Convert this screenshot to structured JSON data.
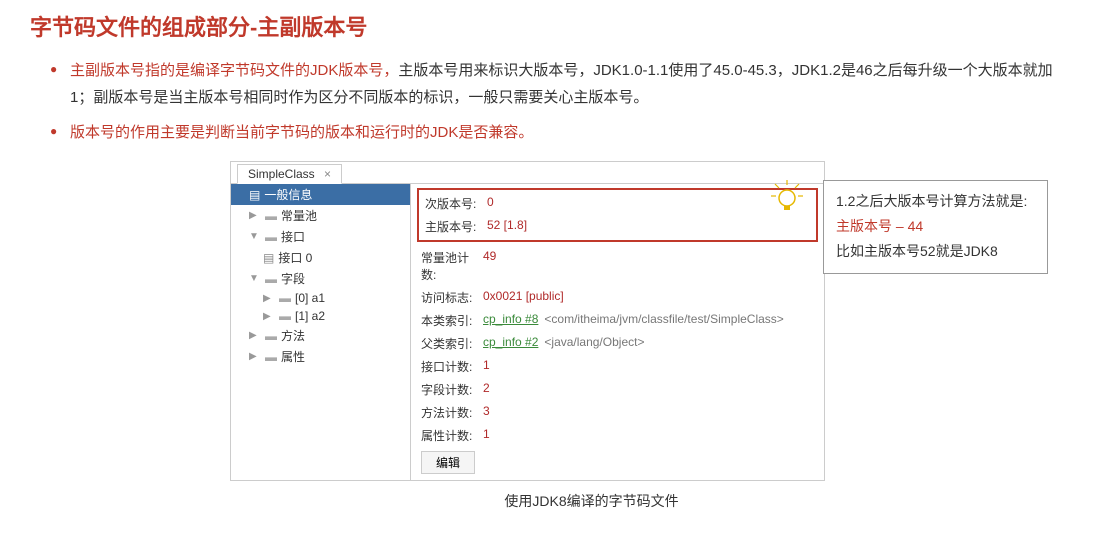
{
  "title": "字节码文件的组成部分-主副版本号",
  "bullets": {
    "b1_red": "主副版本号指的是编译字节码文件的JDK版本号，",
    "b1_black": "主版本号用来标识大版本号，JDK1.0-1.1使用了45.0-45.3，JDK1.2是46之后每升级一个大版本就加1；副版本号是当主版本号相同时作为区分不同版本的标识，一般只需要关心主版本号。",
    "b2_red": "版本号的作用主要是判断当前字节码的版本和运行时的JDK是否兼容。"
  },
  "infobox": {
    "line1": "1.2之后大版本号计算方法就是:",
    "line2": "主版本号 – 44",
    "line3": "比如主版本号52就是JDK8"
  },
  "lightbulb": "💡",
  "panel": {
    "tab": "SimpleClass",
    "tab_close": "×",
    "tree": {
      "n0": "一般信息",
      "n1": "常量池",
      "n2": "接口",
      "n2a": "接口 0",
      "n3": "字段",
      "n3a": "[0] a1",
      "n3b": "[1] a2",
      "n4": "方法",
      "n5": "属性"
    },
    "details": {
      "minor_label": "次版本号:",
      "minor_val": "0",
      "major_label": "主版本号:",
      "major_val": "52 [1.8]",
      "cpool_label": "常量池计数:",
      "cpool_val": "49",
      "access_label": "访问标志:",
      "access_val": "0x0021 [public]",
      "this_label": "本类索引:",
      "this_val": "cp_info #8",
      "this_extra": "<com/itheima/jvm/classfile/test/SimpleClass>",
      "super_label": "父类索引:",
      "super_val": "cp_info #2",
      "super_extra": "<java/lang/Object>",
      "iface_label": "接口计数:",
      "iface_val": "1",
      "field_label": "字段计数:",
      "field_val": "2",
      "method_label": "方法计数:",
      "method_val": "3",
      "attr_label": "属性计数:",
      "attr_val": "1",
      "edit_btn": "编辑"
    }
  },
  "caption": "使用JDK8编译的字节码文件"
}
